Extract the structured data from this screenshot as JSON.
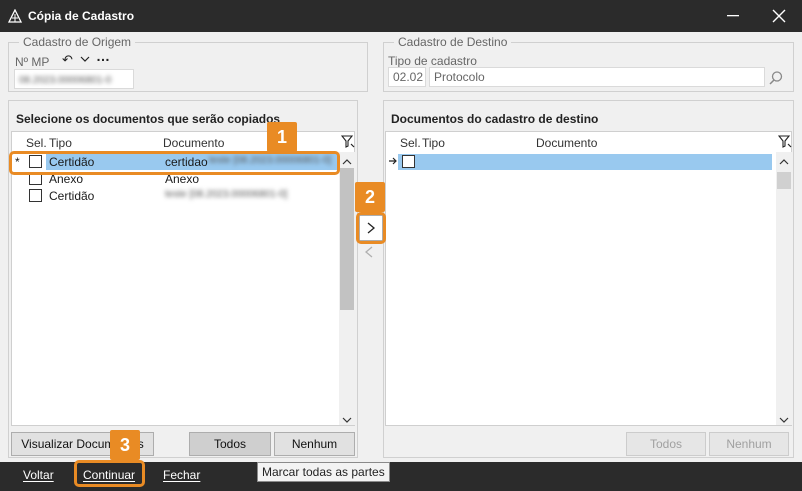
{
  "window": {
    "title": "Cópia de Cadastro"
  },
  "origem": {
    "group_label": "Cadastro de Origem",
    "mp_label": "Nº MP",
    "mp_value": "08.2023.00006801-0"
  },
  "destino": {
    "group_label": "Cadastro de Destino",
    "tipo_label": "Tipo de cadastro",
    "tipo_code": "02.02",
    "tipo_name": "Protocolo"
  },
  "left_panel": {
    "title": "Selecione os documentos que serão copiados",
    "col_sel": "Sel.",
    "col_tipo": "Tipo",
    "col_doc": "Documento",
    "rows": [
      {
        "marker": "*",
        "tipo": "Certidão",
        "documento": "certidao",
        "doc_extra": "teste [08.2023.00006801-0]"
      },
      {
        "marker": "",
        "tipo": "Anexo",
        "documento": "Anexo",
        "doc_extra": ""
      },
      {
        "marker": "",
        "tipo": "Certidão",
        "documento": "",
        "doc_extra": "teste [08.2023.00006801-0]"
      }
    ],
    "btn_visualizar": "Visualizar Documentos",
    "btn_todos": "Todos",
    "btn_nenhum": "Nenhum"
  },
  "right_panel": {
    "title": "Documentos do cadastro de destino",
    "col_sel": "Sel.",
    "col_tipo": "Tipo",
    "col_doc": "Documento",
    "btn_todos": "Todos",
    "btn_nenhum": "Nenhum"
  },
  "footer": {
    "voltar": "Voltar",
    "continuar": "Continuar",
    "fechar": "Fechar",
    "tooltip": "Marcar todas as partes"
  },
  "badges": {
    "b1": "1",
    "b2": "2",
    "b3": "3"
  },
  "colors": {
    "accent": "#e98b24",
    "selection": "#99c9ef",
    "dark_bar": "#2b2b2b"
  }
}
